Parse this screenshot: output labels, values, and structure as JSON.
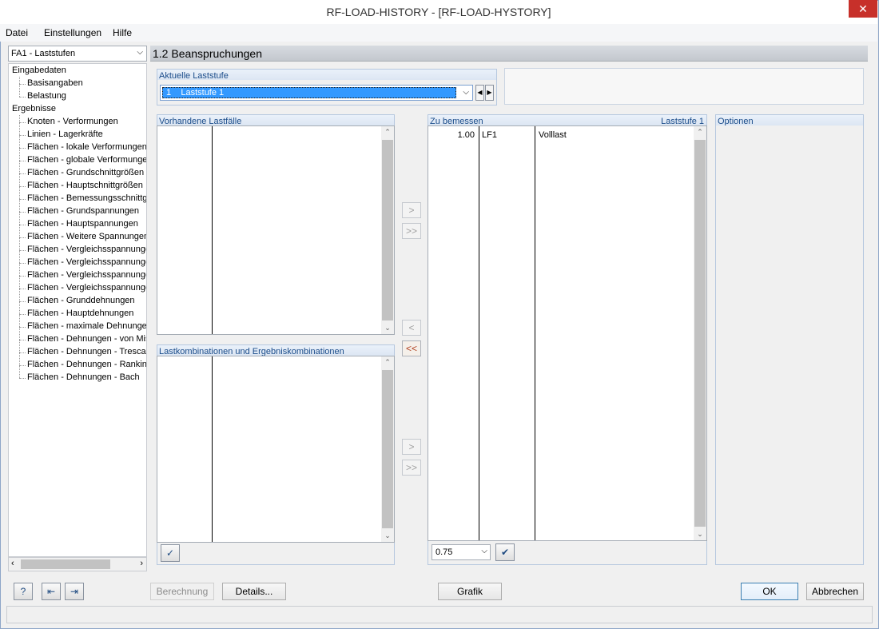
{
  "window": {
    "title": "RF-LOAD-HISTORY - [RF-LOAD-HYSTORY]",
    "close_glyph": "✕"
  },
  "menu": {
    "file": "Datei",
    "settings": "Einstellungen",
    "help": "Hilfe"
  },
  "nav": {
    "case_select": "FA1 - Laststufen",
    "tree": [
      {
        "label": "Eingabedaten",
        "level": 0
      },
      {
        "label": "Basisangaben",
        "level": 1
      },
      {
        "label": "Belastung",
        "level": 1
      },
      {
        "label": "Ergebnisse",
        "level": 0
      },
      {
        "label": "Knoten - Verformungen",
        "level": 1
      },
      {
        "label": "Linien - Lagerkräfte",
        "level": 1
      },
      {
        "label": "Flächen - lokale Verformungen",
        "level": 1
      },
      {
        "label": "Flächen - globale Verformungen",
        "level": 1
      },
      {
        "label": "Flächen - Grundschnittgrößen",
        "level": 1
      },
      {
        "label": "Flächen - Hauptschnittgrößen",
        "level": 1
      },
      {
        "label": "Flächen - Bemessungsschnittgrößen",
        "level": 1
      },
      {
        "label": "Flächen - Grundspannungen",
        "level": 1
      },
      {
        "label": "Flächen - Hauptspannungen",
        "level": 1
      },
      {
        "label": "Flächen - Weitere Spannungen",
        "level": 1
      },
      {
        "label": "Flächen - Vergleichsspannungen",
        "level": 1
      },
      {
        "label": "Flächen - Vergleichsspannungen",
        "level": 1
      },
      {
        "label": "Flächen - Vergleichsspannungen",
        "level": 1
      },
      {
        "label": "Flächen - Vergleichsspannungen",
        "level": 1
      },
      {
        "label": "Flächen - Grunddehnungen",
        "level": 1
      },
      {
        "label": "Flächen - Hauptdehnungen",
        "level": 1
      },
      {
        "label": "Flächen - maximale Dehnungen",
        "level": 1
      },
      {
        "label": "Flächen - Dehnungen - von Mises",
        "level": 1
      },
      {
        "label": "Flächen - Dehnungen - Tresca",
        "level": 1
      },
      {
        "label": "Flächen - Dehnungen - Rankine",
        "level": 1
      },
      {
        "label": "Flächen - Dehnungen - Bach",
        "level": 1
      }
    ]
  },
  "main": {
    "header": "1.2 Beanspruchungen",
    "current_step": {
      "label": "Aktuelle Laststufe",
      "value": "1    Laststufe 1"
    },
    "available_cases": {
      "label": "Vorhandene Lastfälle"
    },
    "combinations": {
      "label": "Lastkombinationen und Ergebniskombinationen"
    },
    "to_design": {
      "label": "Zu bemessen",
      "step_label": "Laststufe 1",
      "rows": [
        {
          "factor": "1.00",
          "case": "LF1",
          "description": "Volllast"
        }
      ],
      "factor_select": "0.75"
    },
    "options": {
      "label": "Optionen"
    },
    "transfer": {
      "one": ">",
      "all": ">>",
      "back": "<",
      "back_all": "<<"
    }
  },
  "footer": {
    "calculation": "Berechnung",
    "details": "Details...",
    "graphic": "Grafik",
    "ok": "OK",
    "cancel": "Abbrechen"
  }
}
